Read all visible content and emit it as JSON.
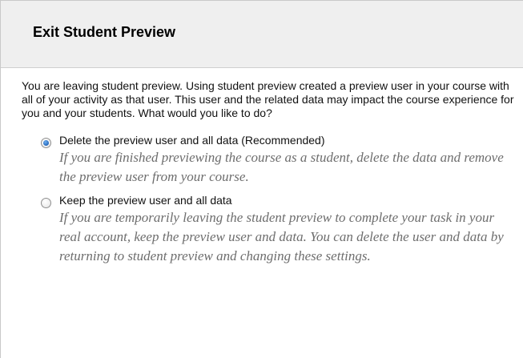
{
  "dialog": {
    "title": "Exit Student Preview",
    "intro": "You are leaving student preview. Using student preview created a preview user in your course with all of your activity as that user. This user and the related data may impact the course experience for you and your students. What would you like to do?",
    "options": [
      {
        "label": "Delete the preview user and all data (Recommended)",
        "description": "If you are finished previewing the course as a student, delete the data and remove the preview user from your course.",
        "selected": true
      },
      {
        "label": "Keep the preview user and all data",
        "description": "If you are temporarily leaving the student preview to complete your task in your real account, keep the preview user and data. You can delete the user and data by returning to student preview and changing these settings.",
        "selected": false
      }
    ]
  }
}
